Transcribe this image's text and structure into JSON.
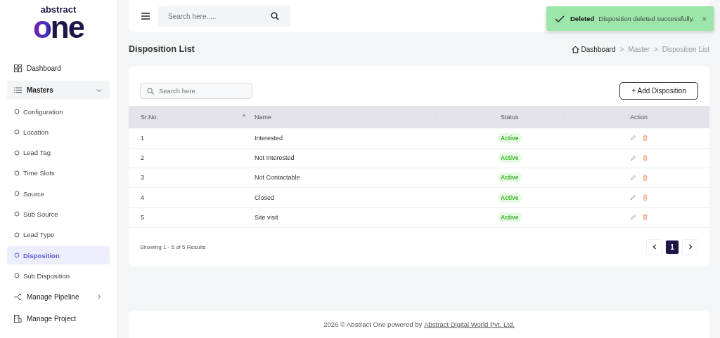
{
  "logo": {
    "top": "abstract",
    "bottom": "one"
  },
  "sidebar": {
    "items": [
      {
        "kind": "link",
        "label": "Dashboard"
      },
      {
        "kind": "group",
        "label": "Masters",
        "expanded": true,
        "children": [
          {
            "label": "Configuration",
            "selected": false
          },
          {
            "label": "Location",
            "selected": false
          },
          {
            "label": "Lead Tag",
            "selected": false
          },
          {
            "label": "Time Slots",
            "selected": false
          },
          {
            "label": "Source",
            "selected": false
          },
          {
            "label": "Sub Source",
            "selected": false
          },
          {
            "label": "Lead Type",
            "selected": false
          },
          {
            "label": "Disposition",
            "selected": true
          },
          {
            "label": "Sub Disposition",
            "selected": false
          }
        ]
      },
      {
        "kind": "group",
        "label": "Manage Pipeline",
        "expanded": false
      },
      {
        "kind": "link",
        "label": "Manage Project"
      }
    ]
  },
  "header": {
    "search": {
      "placeholder": "Search here....."
    }
  },
  "toast": {
    "title": "Deleted",
    "message": "Disposition deleted successfully.",
    "close": "×"
  },
  "page": {
    "title": "Disposition List",
    "breadcrumb": [
      "Dashboard",
      "Master",
      "Disposition List"
    ],
    "breadcrumb_separator": ">"
  },
  "toolbar": {
    "search": {
      "placeholder": "Search here"
    },
    "add_button": "+ Add Disposition"
  },
  "table": {
    "columns": [
      {
        "label": "Sr.No.",
        "sorted_ascending": true
      },
      {
        "label": "Name",
        "sorted_ascending": false
      },
      {
        "label": "Status",
        "sorted_ascending": false
      },
      {
        "label": "Action"
      }
    ],
    "rows": [
      {
        "sr": "1",
        "name": "Interested",
        "status": "Active"
      },
      {
        "sr": "2",
        "name": "Not Interested",
        "status": "Active"
      },
      {
        "sr": "3",
        "name": "Not Contactable",
        "status": "Active"
      },
      {
        "sr": "4",
        "name": "Closed",
        "status": "Active"
      },
      {
        "sr": "5",
        "name": "Site visit",
        "status": "Active"
      }
    ]
  },
  "pagination": {
    "summary": "Showing 1 - 5 of 5 Results",
    "pages": [
      {
        "label": "1",
        "selected": true
      }
    ]
  },
  "footer": {
    "text": "2026 © Abstract One powered by",
    "link": "Abstract Digital World Pvt. Ltd."
  }
}
